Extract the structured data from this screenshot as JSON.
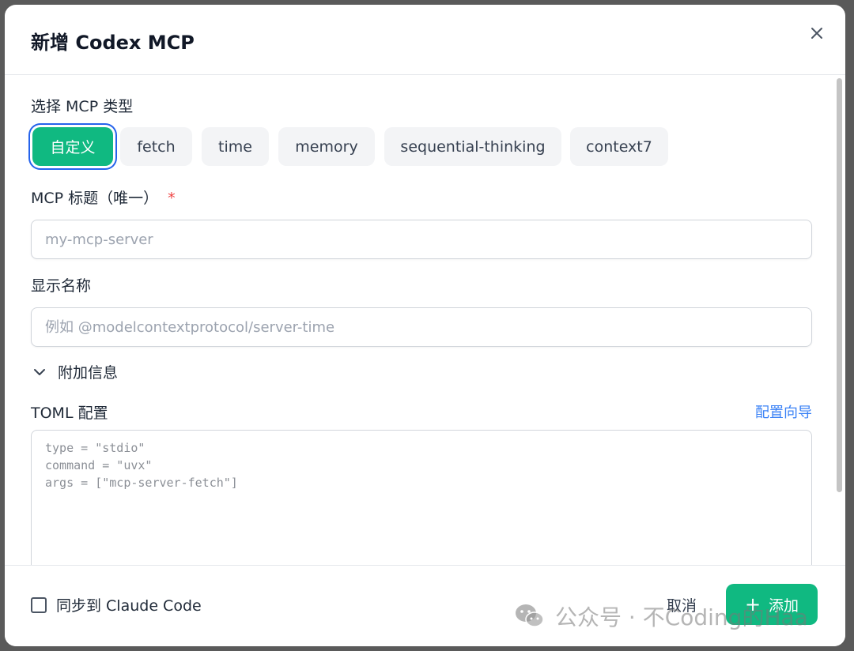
{
  "dialog": {
    "title": "新增 Codex MCP",
    "close_icon": "close-icon"
  },
  "mcp_type": {
    "label": "选择 MCP 类型",
    "options": [
      "自定义",
      "fetch",
      "time",
      "memory",
      "sequential-thinking",
      "context7"
    ],
    "selected": "自定义"
  },
  "mcp_title": {
    "label": "MCP 标题（唯一）",
    "required_mark": "*",
    "value": "",
    "placeholder": "my-mcp-server"
  },
  "display_name": {
    "label": "显示名称",
    "value": "",
    "placeholder": "例如 @modelcontextprotocol/server-time"
  },
  "extra_info": {
    "label": "附加信息",
    "icon": "chevron-down-icon"
  },
  "toml": {
    "label": "TOML 配置",
    "wizard_link": "配置向导",
    "value": "",
    "placeholder": "type = \"stdio\"\ncommand = \"uvx\"\nargs = [\"mcp-server-fetch\"]"
  },
  "footer": {
    "sync_label": "同步到 Claude Code",
    "sync_checked": false,
    "cancel_label": "取消",
    "add_label": "添加",
    "add_icon": "plus-icon"
  },
  "watermark": {
    "text": "公众号 · 不Coding的Haa",
    "icon": "wechat-icon"
  },
  "colors": {
    "accent": "#10b981",
    "focus_ring": "#2563eb",
    "link": "#3b82f6",
    "required": "#ef4444"
  }
}
